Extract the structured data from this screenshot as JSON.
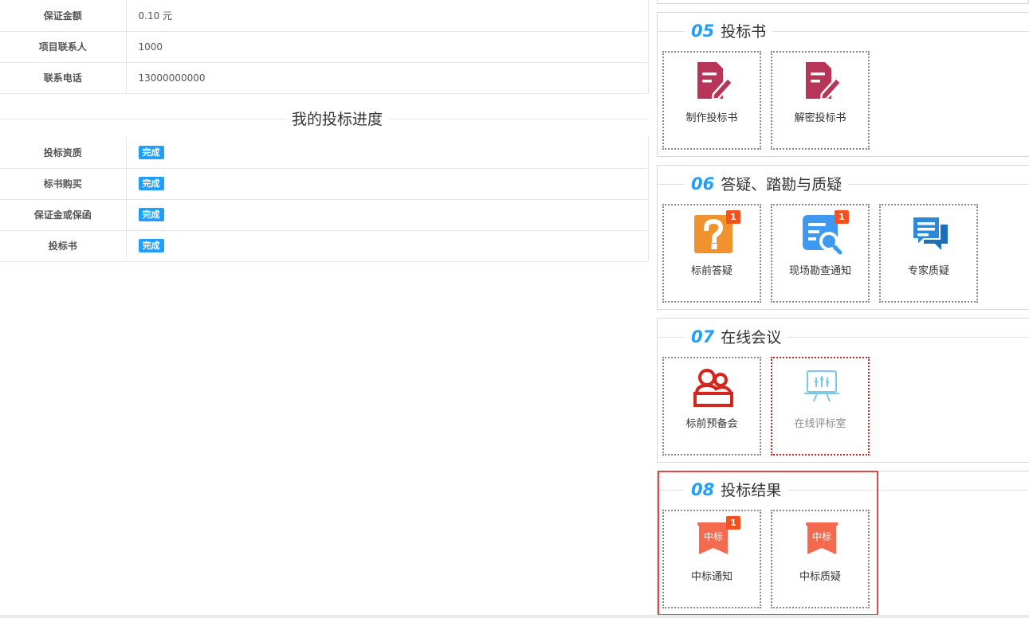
{
  "info_table": [
    {
      "label": "保证金额",
      "value": "0.10 元"
    },
    {
      "label": "项目联系人",
      "value": "1000"
    },
    {
      "label": "联系电话",
      "value": "13000000000"
    }
  ],
  "progress": {
    "title": "我的投标进度",
    "rows": [
      {
        "label": "投标资质",
        "status": "完成"
      },
      {
        "label": "标书购买",
        "status": "完成"
      },
      {
        "label": "保证金或保函",
        "status": "完成"
      },
      {
        "label": "投标书",
        "status": "完成"
      }
    ]
  },
  "sections": [
    {
      "num": "05",
      "name": "投标书",
      "cards": [
        {
          "label": "制作投标书",
          "icon": "edit-document-icon"
        },
        {
          "label": "解密投标书",
          "icon": "edit-document-icon"
        }
      ]
    },
    {
      "num": "06",
      "name": "答疑、踏勘与质疑",
      "cards": [
        {
          "label": "标前答疑",
          "icon": "question-icon",
          "count": "1"
        },
        {
          "label": "现场勘查通知",
          "icon": "inspection-search-icon",
          "count": "1"
        },
        {
          "label": "专家质疑",
          "icon": "chat-bubbles-icon"
        }
      ]
    },
    {
      "num": "07",
      "name": "在线会议",
      "cards": [
        {
          "label": "标前预备会",
          "icon": "meeting-people-icon"
        },
        {
          "label": "在线评标室",
          "icon": "presentation-board-icon"
        }
      ]
    },
    {
      "num": "08",
      "name": "投标结果",
      "cards": [
        {
          "label": "中标通知",
          "icon": "win-bid-ribbon-icon",
          "count": "1",
          "icon_text": "中标"
        },
        {
          "label": "中标质疑",
          "icon": "win-bid-ribbon-icon",
          "icon_text": "中标"
        }
      ]
    }
  ],
  "colors": {
    "accent": "#1e9fff",
    "badge_red": "#f4511e",
    "doc_icon": "#b8355a",
    "question_icon": "#f0922e",
    "meeting_icon": "#d4261c",
    "ribbon_icon": "#f46a4e",
    "highlight_border": "#e04848"
  }
}
